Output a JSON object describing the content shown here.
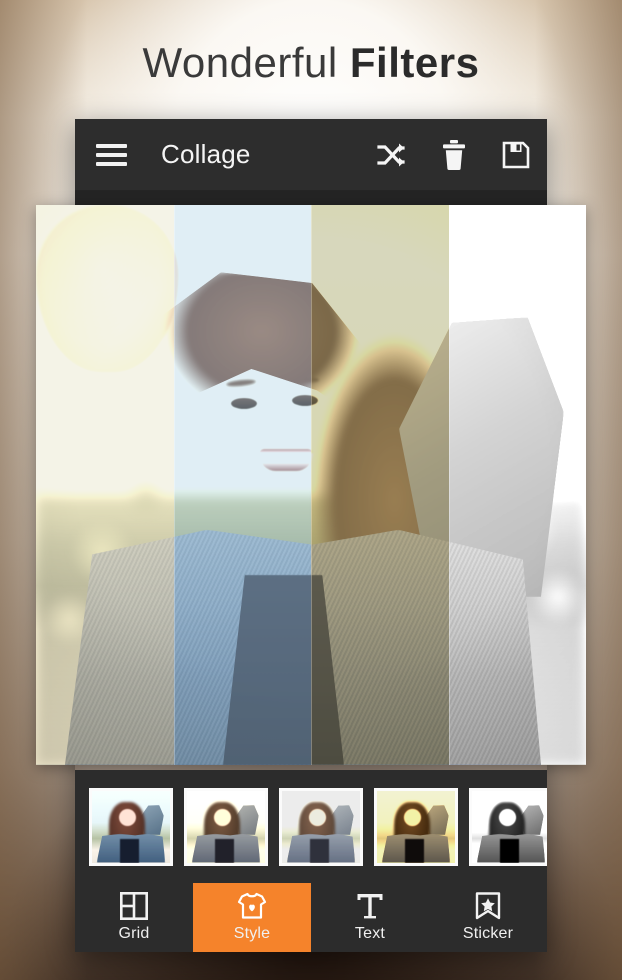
{
  "promo": {
    "headline_light": "Wonderful",
    "headline_bold": "Filters"
  },
  "appbar": {
    "menu_icon": "hamburger-menu-icon",
    "title": "Collage",
    "actions": [
      {
        "icon": "shuffle-icon",
        "label": "Shuffle"
      },
      {
        "icon": "trash-icon",
        "label": "Delete"
      },
      {
        "icon": "save-floppy-icon",
        "label": "Save"
      }
    ]
  },
  "canvas": {
    "type": "collage-preview",
    "filter_strips": [
      {
        "name": "cream",
        "color": "#fbf8d6"
      },
      {
        "name": "sky-blue",
        "color": "#bee2f5"
      },
      {
        "name": "olive-vintage",
        "color": "#bcbc96"
      },
      {
        "name": "white-mono",
        "color": "#ffffff"
      }
    ]
  },
  "filter_strip": {
    "selected_index": 1,
    "thumbnails": [
      {
        "name": "cool-blue-filter"
      },
      {
        "name": "cream-sepia-filter"
      },
      {
        "name": "faded-warm-filter"
      },
      {
        "name": "vintage-yellow-filter"
      },
      {
        "name": "black-white-sketch-filter"
      }
    ]
  },
  "tabbar": {
    "active_index": 1,
    "accent_color": "#f5832b",
    "tabs": [
      {
        "label": "Grid",
        "icon": "grid-layout-icon"
      },
      {
        "label": "Style",
        "icon": "tshirt-heart-icon"
      },
      {
        "label": "Text",
        "icon": "text-t-icon"
      },
      {
        "label": "Sticker",
        "icon": "bookmark-star-icon"
      }
    ]
  }
}
